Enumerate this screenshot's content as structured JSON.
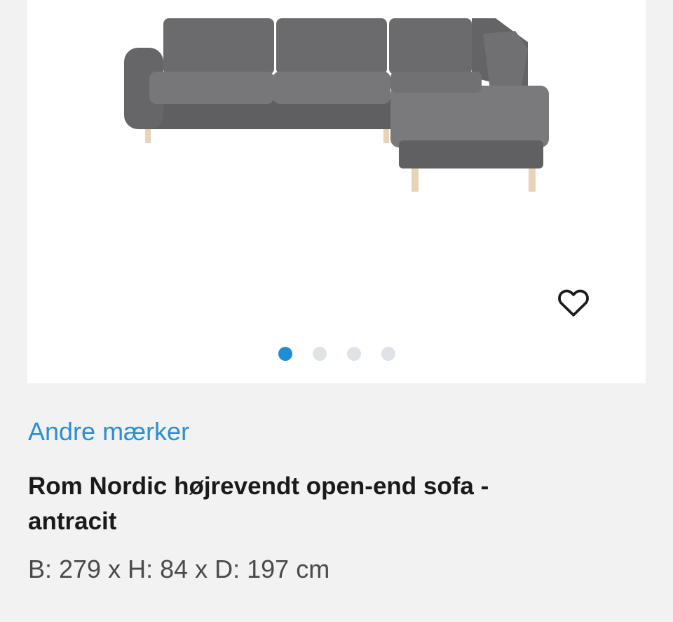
{
  "product": {
    "image_alt": "Grey corner sofa with open end and light wooden legs",
    "brand_link": "Andre mærker",
    "title": "Rom Nordic højrevendt open-end sofa - antracit",
    "dimensions": "B: 279 x H: 84 x D: 197 cm"
  },
  "carousel": {
    "total": 4,
    "active_index": 0
  },
  "icons": {
    "favorite": "heart-outline-icon"
  },
  "colors": {
    "accent": "#1e8fd6",
    "brand_text": "#2b8fd0",
    "background": "#f2f2f2"
  }
}
